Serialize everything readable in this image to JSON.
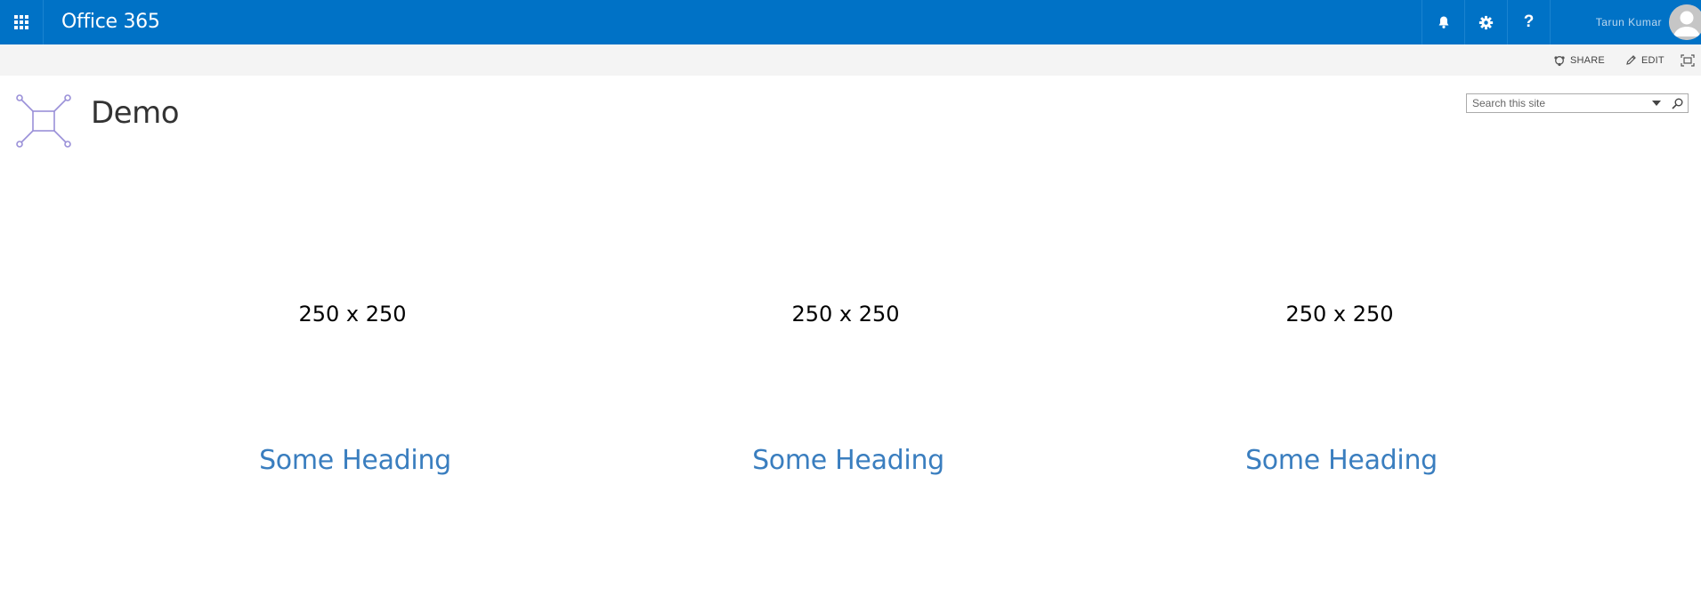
{
  "suite_bar": {
    "app_title": "Office 365",
    "user_name": "Tarun Kumar",
    "icons": {
      "waffle": "app-launcher-icon",
      "notifications": "bell-icon",
      "settings": "gear-icon",
      "help": "help-icon"
    },
    "help_glyph": "?",
    "accent": "#0072c6"
  },
  "actions": {
    "share_label": "SHARE",
    "edit_label": "EDIT"
  },
  "site": {
    "title": "Demo"
  },
  "search": {
    "placeholder": "Search this site"
  },
  "columns": [
    {
      "image_label": "250 x 250",
      "heading": "Some Heading"
    },
    {
      "image_label": "250 x 250",
      "heading": "Some Heading"
    },
    {
      "image_label": "250 x 250",
      "heading": "Some Heading"
    }
  ],
  "colors": {
    "heading": "#3a7ebf",
    "actionbar_bg": "#f4f4f4"
  }
}
